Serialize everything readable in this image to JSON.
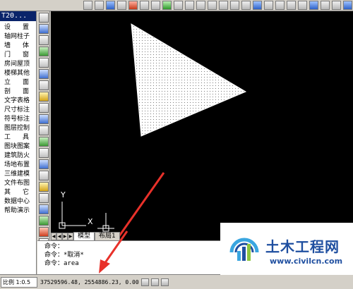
{
  "left_menu": {
    "title": "T20...",
    "items": [
      {
        "label": "设　置",
        "spaced": true
      },
      {
        "label": "轴网柱子",
        "spaced": false
      },
      {
        "label": "墙　体",
        "spaced": true
      },
      {
        "label": "门　窗",
        "spaced": true
      },
      {
        "label": "房间屋顶",
        "spaced": false
      },
      {
        "label": "楼梯其他",
        "spaced": false
      },
      {
        "label": "立　面",
        "spaced": true
      },
      {
        "label": "剖　面",
        "spaced": true
      },
      {
        "label": "文字表格",
        "spaced": false
      },
      {
        "label": "尺寸标注",
        "spaced": false
      },
      {
        "label": "符号标注",
        "spaced": false
      },
      {
        "label": "图层控制",
        "spaced": false
      },
      {
        "label": "工　具",
        "spaced": true
      },
      {
        "label": "图块图案",
        "spaced": false
      },
      {
        "label": "建筑防火",
        "spaced": false
      },
      {
        "label": "场地布置",
        "spaced": false
      },
      {
        "label": "三维建模",
        "spaced": false
      },
      {
        "label": "文件布图",
        "spaced": false
      },
      {
        "label": "其　它",
        "spaced": true
      },
      {
        "label": "数据中心",
        "spaced": false
      },
      {
        "label": "帮助演示",
        "spaced": false
      }
    ]
  },
  "canvas": {
    "ucs_x_label": "X",
    "ucs_y_label": "Y"
  },
  "tabs": {
    "items": [
      {
        "label": "模型",
        "active": true
      },
      {
        "label": "布局1",
        "active": false
      }
    ]
  },
  "command": {
    "lines": [
      "命令：",
      "命令：*取消*",
      "命令：area"
    ]
  },
  "status": {
    "scale": "比例 1:0.5",
    "coordinates": "37529596.48, 2554886.23, 0.00"
  },
  "watermark": {
    "title": "土木工程网",
    "url": "www.civilcn.com"
  },
  "colors": {
    "canvas_bg": "#000000",
    "triangle_fill": "#ffffff",
    "arrow": "#e8312a",
    "menu_title_bg": "#0a246a",
    "watermark_blue": "#1f4fa0"
  }
}
